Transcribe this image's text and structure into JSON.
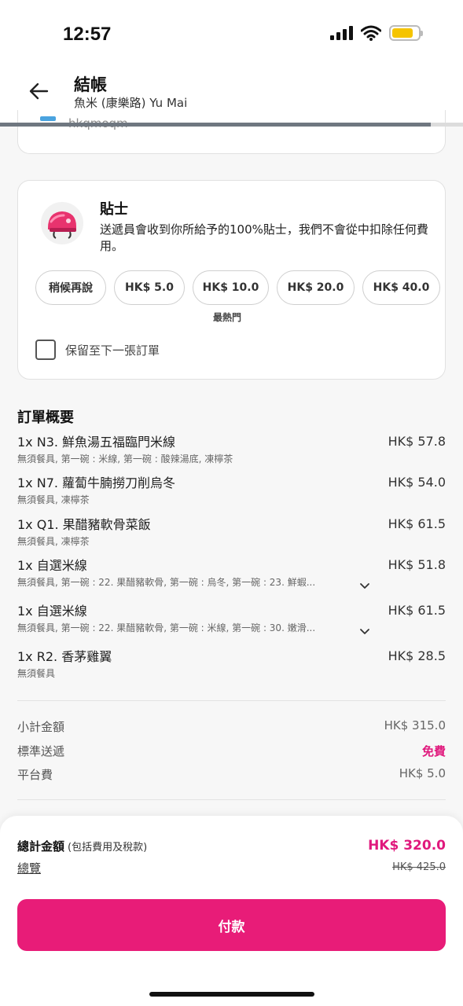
{
  "status_bar": {
    "time": "12:57"
  },
  "header": {
    "title": "結帳",
    "restaurant": "魚米 (康樂路) Yu Mai"
  },
  "partial_card": {
    "text": "hkqmoqm"
  },
  "tip": {
    "title": "貼士",
    "description": "送遞員會收到你所給予的100%貼士，我們不會從中扣除任何費用。",
    "options": [
      "稍候再說",
      "HK$ 5.0",
      "HK$ 10.0",
      "HK$ 20.0",
      "HK$ 40.0"
    ],
    "popular_label": "最熱門",
    "keep_label": "保留至下一張訂單",
    "helmet_color": "#e8336e"
  },
  "order_summary": {
    "title": "訂單概要",
    "items": [
      {
        "name": "1x N3. 鮮魚湯五福臨門米線",
        "price": "HK$ 57.8",
        "options": "無須餐具, 第一碗 : 米線, 第一碗 : 酸辣湯底, 凍檸茶"
      },
      {
        "name": "1x N7. 蘿蔔牛腩撈刀削烏冬",
        "price": "HK$ 54.0",
        "options": "無須餐具, 凍檸茶"
      },
      {
        "name": "1x Q1. 果醋豬軟骨菜飯",
        "price": "HK$ 61.5",
        "options": "無須餐具, 凍檸茶"
      },
      {
        "name": "1x 自選米線",
        "price": "HK$ 51.8",
        "options": "無須餐具, 第一碗 : 22. 果醋豬軟骨, 第一碗 : 烏冬, 第一碗 : 23. 鮮蝦..."
      },
      {
        "name": "1x 自選米線",
        "price": "HK$ 61.5",
        "options": "無須餐具, 第一碗 : 22. 果醋豬軟骨, 第一碗 : 米線, 第一碗 : 30. 嫩滑..."
      },
      {
        "name": "1x R2. 香茅雞翼",
        "price": "HK$ 28.5",
        "options": "無須餐具"
      }
    ]
  },
  "fees": {
    "subtotal_label": "小計金額",
    "subtotal": "HK$ 315.0",
    "delivery_label": "標準送遞",
    "delivery": "免費",
    "platform_label": "平台費",
    "platform": "HK$ 5.0"
  },
  "total": {
    "label": "總計金額",
    "note": "(包括費用及稅款)",
    "overview": "總覽",
    "price": "HK$ 320.0",
    "old_price": "HK$ 425.0"
  },
  "pay_button": "付款",
  "colors": {
    "brand": "#e81c78",
    "accent_text": "#e0197d"
  }
}
